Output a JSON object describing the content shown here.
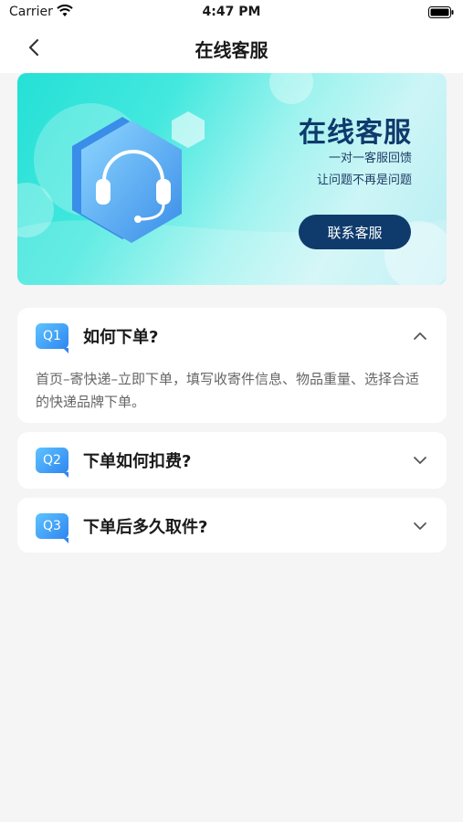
{
  "status_bar": {
    "carrier": "Carrier",
    "time": "4:47 PM"
  },
  "nav": {
    "title": "在线客服"
  },
  "banner": {
    "title": "在线客服",
    "subtitle_line1": "一对一客服回馈",
    "subtitle_line2": "让问题不再是问题",
    "contact_button": "联系客服",
    "accent_color": "#0f3b6c"
  },
  "faq": [
    {
      "badge": "Q1",
      "question": "如何下单?",
      "expanded": true,
      "answer": "首页–寄快递–立即下单，填写收寄件信息、物品重量、选择合适的快递品牌下单。"
    },
    {
      "badge": "Q2",
      "question": "下单如何扣费?",
      "expanded": false
    },
    {
      "badge": "Q3",
      "question": "下单后多久取件?",
      "expanded": false
    }
  ]
}
